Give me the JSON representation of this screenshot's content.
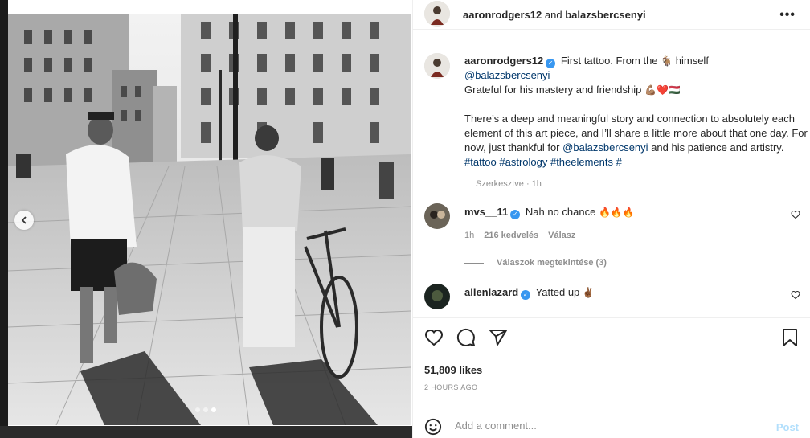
{
  "header": {
    "user1": "aaronrodgers12",
    "and_text": "and",
    "user2": "balazsbercsenyi",
    "more_label": "•••"
  },
  "caption": {
    "username": "aaronrodgers12",
    "line1_a": "First tattoo. From the",
    "line1_emoji": "🐐",
    "line1_b": "himself",
    "mention": "@balazsbercsenyi",
    "line2": "Grateful for his mastery and friendship",
    "line2_emoji": "💪🏽❤️🇭🇺",
    "para_a": "There’s a deep and meaningful story and connection to absolutely each element of this art piece, and I’ll share a little more about that one day. For now, just thankful for",
    "para_mention": "@balazsbercsenyi",
    "para_b": "and his patience and artistry.",
    "tags": "#tattoo #astrology #theelements #",
    "edited": "Szerkesztve · 1h"
  },
  "comments": [
    {
      "username": "mvs__11",
      "text": "Nah no chance",
      "emoji": "🔥🔥🔥",
      "time": "1h",
      "likes": "216 kedvelés",
      "reply": "Válasz",
      "view_replies": "Válaszok megtekintése (3)"
    },
    {
      "username": "allenlazard",
      "text": "Yatted up",
      "emoji": "✌🏾"
    }
  ],
  "stats": {
    "likes": "51,809 likes",
    "time": "2 HOURS AGO"
  },
  "add_comment": {
    "placeholder": "Add a comment...",
    "post_label": "Post"
  },
  "icons": {
    "more": "more-options-icon",
    "like": "heart-icon",
    "comment": "comment-icon",
    "share": "share-icon",
    "save": "bookmark-icon",
    "emoji": "emoji-icon",
    "prev": "chevron-left-icon",
    "verified": "verified-badge-icon"
  },
  "colors": {
    "link": "#00376b",
    "verified": "#3897f0",
    "muted": "#8e8e8e",
    "post_disabled": "#b2dffc"
  },
  "carousel": {
    "slides": 3,
    "active_index": 2
  }
}
